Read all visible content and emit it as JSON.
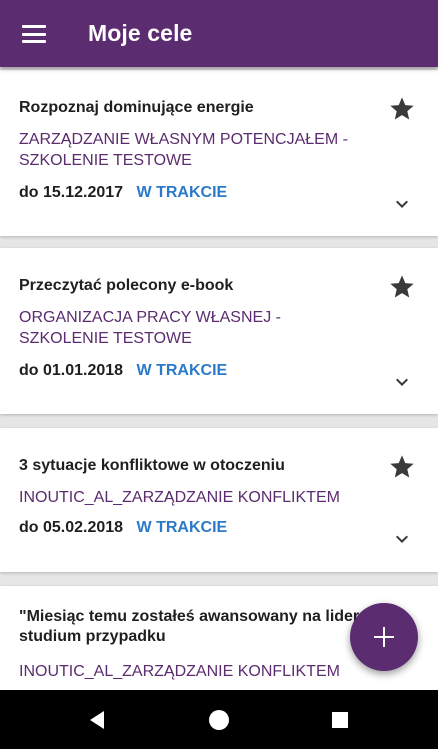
{
  "appbar": {
    "title": "Moje cele",
    "menu_icon": "hamburger-menu-icon",
    "background": "#5b2c6f"
  },
  "goals": [
    {
      "title": "Rozpoznaj dominujące energie",
      "course": "ZARZĄDZANIE WŁASNYM POTENCJAŁEM - SZKOLENIE TESTOWE",
      "date": "do 15.12.2017",
      "status": "W TRAKCIE",
      "starred": true
    },
    {
      "title": "Przeczytać polecony e-book",
      "course": "ORGANIZACJA PRACY WŁASNEJ - SZKOLENIE TESTOWE",
      "date": "do 01.01.2018",
      "status": "W TRAKCIE",
      "starred": true
    },
    {
      "title": "3 sytuacje konfliktowe w otoczeniu",
      "course": "INOUTIC_AL_ZARZĄDZANIE KONFLIKTEM",
      "date": "do 05.02.2018",
      "status": "W TRAKCIE",
      "starred": true
    },
    {
      "title": "\"Miesiąc temu zostałeś awansowany na lidera...\" studium przypadku",
      "course": "INOUTIC_AL_ZARZĄDZANIE KONFLIKTEM",
      "date": "",
      "status": "",
      "starred": true
    }
  ],
  "colors": {
    "accent": "#5b2c6f",
    "status": "#2b7ac9",
    "background": "#e6e6e6"
  },
  "fab": {
    "icon": "plus-icon"
  },
  "navbar": {
    "icons": [
      "back-icon",
      "home-icon",
      "recents-icon"
    ]
  }
}
